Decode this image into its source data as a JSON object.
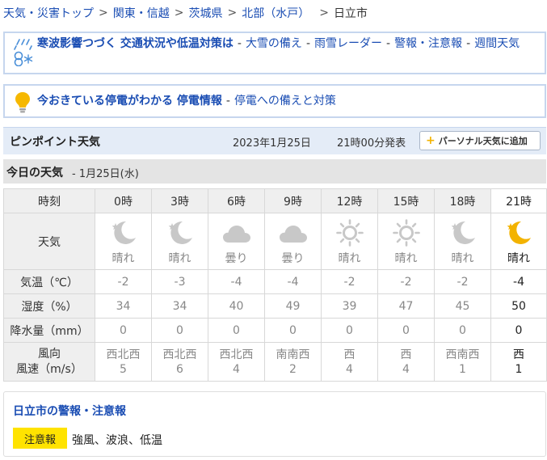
{
  "breadcrumb": {
    "items": [
      "天気・災害トップ",
      "関東・信越",
      "茨城県",
      "北部（水戸）"
    ],
    "separator": ">",
    "current": "日立市"
  },
  "banner1": {
    "icon": "snow-icon",
    "headline": "寒波影響つづく 交通状況や低温対策は",
    "links": [
      "大雪の備え",
      "雨雪レーダー",
      "警報・注意報",
      "週間天気"
    ]
  },
  "banner2": {
    "icon": "lightbulb-icon",
    "headline": "今おきている停電がわかる 停電情報",
    "links": [
      "停電への備えと対策"
    ]
  },
  "pinpoint": {
    "title": "ピンポイント天気",
    "date": "2023年1月25日",
    "time": "21時00分発表",
    "add_button": "パーソナル天気に追加"
  },
  "today": {
    "title": "今日の天気",
    "date": "- 1月25日(水)"
  },
  "forecast": {
    "labels": {
      "time": "時刻",
      "weather": "天気",
      "temp": "気温（℃）",
      "humidity": "湿度（%）",
      "precip": "降水量（mm）",
      "wind_dir": "風向",
      "wind_speed": "風速（m/s）"
    },
    "hours": [
      "0時",
      "3時",
      "6時",
      "9時",
      "12時",
      "15時",
      "18時",
      "21時"
    ],
    "weather": [
      "晴れ",
      "晴れ",
      "曇り",
      "曇り",
      "晴れ",
      "晴れ",
      "晴れ",
      "晴れ"
    ],
    "weather_icons": [
      "moon-icon",
      "moon-icon",
      "cloud-icon",
      "cloud-icon",
      "sun-icon",
      "sun-icon",
      "moon-icon",
      "moon-icon"
    ],
    "temp": [
      "-2",
      "-3",
      "-4",
      "-4",
      "-2",
      "-2",
      "-2",
      "-4"
    ],
    "humidity": [
      "34",
      "34",
      "40",
      "49",
      "39",
      "47",
      "45",
      "50"
    ],
    "precip": [
      "0",
      "0",
      "0",
      "0",
      "0",
      "0",
      "0",
      "0"
    ],
    "wind_dir": [
      "西北西",
      "西北西",
      "西北西",
      "南南西",
      "西",
      "西",
      "西南西",
      "西"
    ],
    "wind_speed": [
      "5",
      "6",
      "4",
      "2",
      "4",
      "4",
      "1",
      "1"
    ],
    "current_index": 7
  },
  "warnings": {
    "title": "日立市の警報・注意報",
    "badge": "注意報",
    "items": "強風、波浪、低温"
  },
  "colors": {
    "link": "#1a4db3",
    "badge": "#ffe300",
    "header_bg": "#e4ecf7",
    "moon_active": "#f3b300",
    "icon_inactive": "#c8c8c8"
  }
}
